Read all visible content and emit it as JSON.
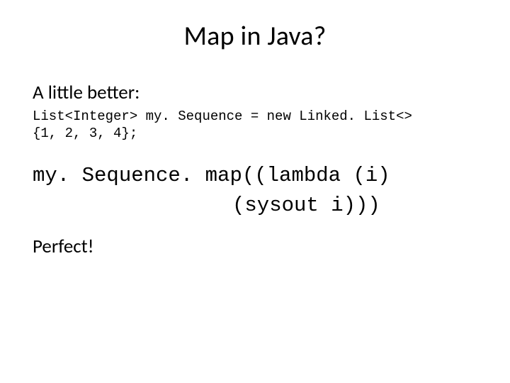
{
  "slide": {
    "title": "Map in Java?",
    "subheading": "A little better:",
    "code_small": {
      "line1": "List<Integer> my. Sequence = new Linked. List<>",
      "line2": "{1, 2, 3, 4};"
    },
    "code_large": {
      "line1": "my. Sequence. map((lambda (i)",
      "line2": "(sysout i)))"
    },
    "footer": "Perfect!"
  }
}
